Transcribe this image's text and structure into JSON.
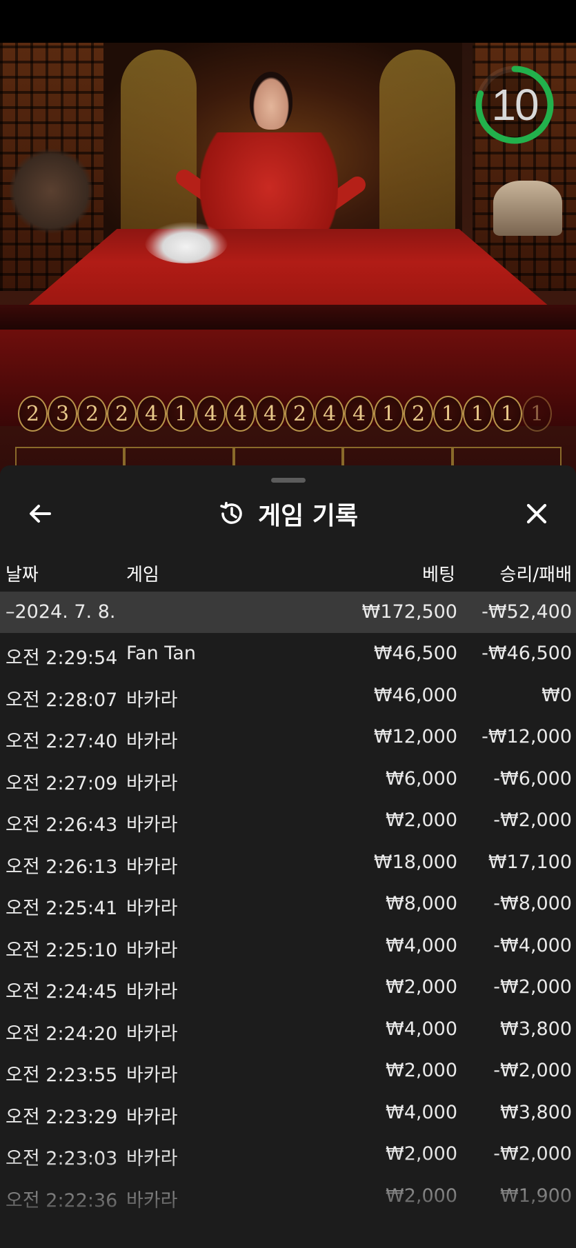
{
  "timer": {
    "seconds": "10",
    "progress": 0.8,
    "color": "#22b14c"
  },
  "results": [
    "2",
    "3",
    "2",
    "2",
    "4",
    "1",
    "4",
    "4",
    "4",
    "2",
    "4",
    "4",
    "1",
    "2",
    "1",
    "1",
    "1",
    "1"
  ],
  "panel": {
    "title": "게임 기록",
    "icons": {
      "back": "arrow-left-icon",
      "history": "history-clock-icon",
      "close": "close-icon"
    }
  },
  "table": {
    "headers": {
      "date": "날짜",
      "game": "게임",
      "bet": "베팅",
      "win": "승리/패배"
    },
    "summary": {
      "date": "–2024. 7. 8.",
      "game": "",
      "bet": "₩172,500",
      "win": "-₩52,400"
    },
    "rows": [
      {
        "time": "오전 2:29:54",
        "game": "Fan Tan",
        "bet": "₩46,500",
        "win": "-₩46,500"
      },
      {
        "time": "오전 2:28:07",
        "game": "바카라",
        "bet": "₩46,000",
        "win": "₩0"
      },
      {
        "time": "오전 2:27:40",
        "game": "바카라",
        "bet": "₩12,000",
        "win": "-₩12,000"
      },
      {
        "time": "오전 2:27:09",
        "game": "바카라",
        "bet": "₩6,000",
        "win": "-₩6,000"
      },
      {
        "time": "오전 2:26:43",
        "game": "바카라",
        "bet": "₩2,000",
        "win": "-₩2,000"
      },
      {
        "time": "오전 2:26:13",
        "game": "바카라",
        "bet": "₩18,000",
        "win": "₩17,100"
      },
      {
        "time": "오전 2:25:41",
        "game": "바카라",
        "bet": "₩8,000",
        "win": "-₩8,000"
      },
      {
        "time": "오전 2:25:10",
        "game": "바카라",
        "bet": "₩4,000",
        "win": "-₩4,000"
      },
      {
        "time": "오전 2:24:45",
        "game": "바카라",
        "bet": "₩2,000",
        "win": "-₩2,000"
      },
      {
        "time": "오전 2:24:20",
        "game": "바카라",
        "bet": "₩4,000",
        "win": "₩3,800"
      },
      {
        "time": "오전 2:23:55",
        "game": "바카라",
        "bet": "₩2,000",
        "win": "-₩2,000"
      },
      {
        "time": "오전 2:23:29",
        "game": "바카라",
        "bet": "₩4,000",
        "win": "₩3,800"
      },
      {
        "time": "오전 2:23:03",
        "game": "바카라",
        "bet": "₩2,000",
        "win": "-₩2,000"
      },
      {
        "time": "오전 2:22:36",
        "game": "바카라",
        "bet": "₩2,000",
        "win": "₩1,900"
      }
    ]
  }
}
